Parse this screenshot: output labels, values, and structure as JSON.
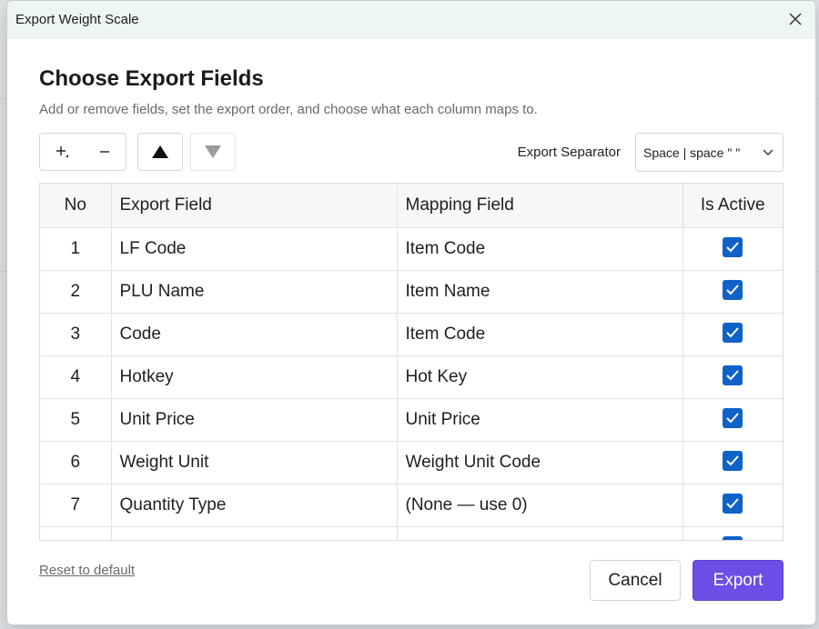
{
  "window": {
    "title": "Export Weight Scale"
  },
  "header": {
    "heading": "Choose Export Fields",
    "subtitle": "Add or remove fields, set the export order, and choose what each column maps to."
  },
  "toolbar": {
    "add_icon": "plus-icon",
    "remove_icon": "minus-icon",
    "move_up_icon": "triangle-up-icon",
    "move_down_icon": "triangle-down-icon",
    "separator_label": "Export Separator",
    "separator_value": "Space | space \" \""
  },
  "table": {
    "headers": {
      "no": "No",
      "export_field": "Export Field",
      "mapping_field": "Mapping Field",
      "is_active": "Is Active"
    },
    "rows": [
      {
        "no": "1",
        "export_field": "LF Code",
        "mapping_field": "Item Code",
        "active": true
      },
      {
        "no": "2",
        "export_field": "PLU Name",
        "mapping_field": "Item Name",
        "active": true
      },
      {
        "no": "3",
        "export_field": "Code",
        "mapping_field": "Item Code",
        "active": true
      },
      {
        "no": "4",
        "export_field": "Hotkey",
        "mapping_field": "Hot Key",
        "active": true
      },
      {
        "no": "5",
        "export_field": "Unit Price",
        "mapping_field": "Unit Price",
        "active": true
      },
      {
        "no": "6",
        "export_field": "Weight Unit",
        "mapping_field": "Weight Unit Code",
        "active": true
      },
      {
        "no": "7",
        "export_field": "Quantity Type",
        "mapping_field": "(None — use 0)",
        "active": true
      },
      {
        "no": "",
        "export_field": "",
        "mapping_field": "",
        "active": true
      }
    ]
  },
  "footer": {
    "reset_label": "Reset to default",
    "cancel_label": "Cancel",
    "export_label": "Export"
  },
  "colors": {
    "accent": "#6c4de6",
    "checkbox": "#0e62c8",
    "titlebar": "#eef6f3"
  }
}
